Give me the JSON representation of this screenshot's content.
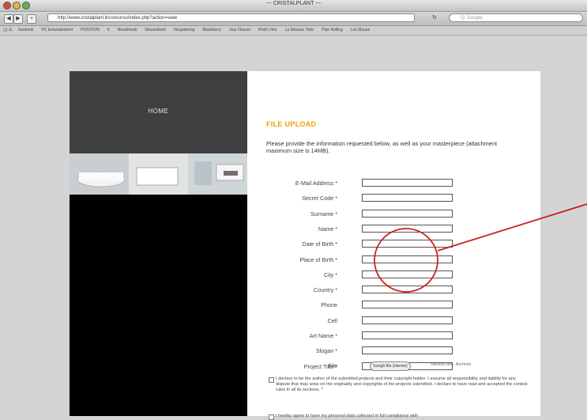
{
  "window": {
    "title": "--- CRISTALPLANT ---"
  },
  "browser": {
    "url": "http://www.cristalplant.it/concorso/index.php?action=view",
    "search_placeholder": "Q- Google",
    "bookmarks": [
      "Seebook",
      "PC Entertainment",
      "POSITION",
      "It",
      "Newsfeeds",
      "Nieuwsfeed",
      "Vergaderlog",
      "Blackberry",
      "Jour Nouvel",
      "Pratt's firm",
      "La Mousse Tetto",
      "Plan Rolling",
      "Les Mouse"
    ]
  },
  "site": {
    "home_label": "HOME",
    "form_heading": "FILE UPLOAD",
    "intro": "Please provide the information requested below, as well as your masterpiece (attachment maximum size is 14MB).",
    "fields": [
      {
        "label": "E-Mail Address *"
      },
      {
        "label": "Secret Code *"
      },
      {
        "label": "Surname *"
      },
      {
        "label": "Name *"
      },
      {
        "label": "Date of Birth *"
      },
      {
        "label": "Place of Birth *"
      },
      {
        "label": "City *"
      },
      {
        "label": "Country *"
      },
      {
        "label": "Phone"
      },
      {
        "label": "Cell"
      },
      {
        "label": "Art Name *"
      },
      {
        "label": "Slogan *"
      },
      {
        "label": "Project Title *"
      }
    ],
    "file_label": "File",
    "file_button": "Scegli file (niente)",
    "file_hint": "Nessun doc. Archivio",
    "declaration_1": "I declare to be the author of the submitted projects and their copyright holder. I assume all responsibility and liability for any dispute that may arise on the originality and copyrights of the projects submitted. I declare to have read and accepted the contest rules in all its sections. *",
    "declaration_2": "I hereby agree to have my personal data collected in full compliance with"
  },
  "colors": {
    "heading": "#f0a000",
    "annotation": "#cc1f1f",
    "dark_panel": "#3f3f3f"
  }
}
